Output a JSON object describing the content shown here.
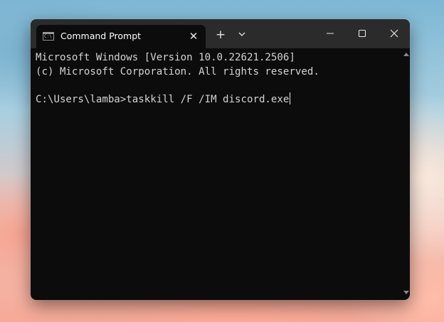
{
  "tab": {
    "icon": "command-prompt-icon",
    "icon_text": "C:\\",
    "title": "Command Prompt",
    "close_icon": "close-icon"
  },
  "titlebar": {
    "new_tab": "+",
    "new_tab_icon": "plus-icon",
    "dropdown_icon": "chevron-down-icon",
    "minimize_icon": "minimize-icon",
    "maximize_icon": "maximize-icon",
    "close_icon": "close-icon"
  },
  "console": {
    "lines": [
      "Microsoft Windows [Version 10.0.22621.2506]",
      "(c) Microsoft Corporation. All rights reserved.",
      "C:\\Users\\lamba>taskkill /F /IM discord.exe"
    ]
  },
  "colors": {
    "console_bg": "#0c0c0c",
    "titlebar_bg": "#2b2b2b",
    "text": "#d4d4d4"
  }
}
